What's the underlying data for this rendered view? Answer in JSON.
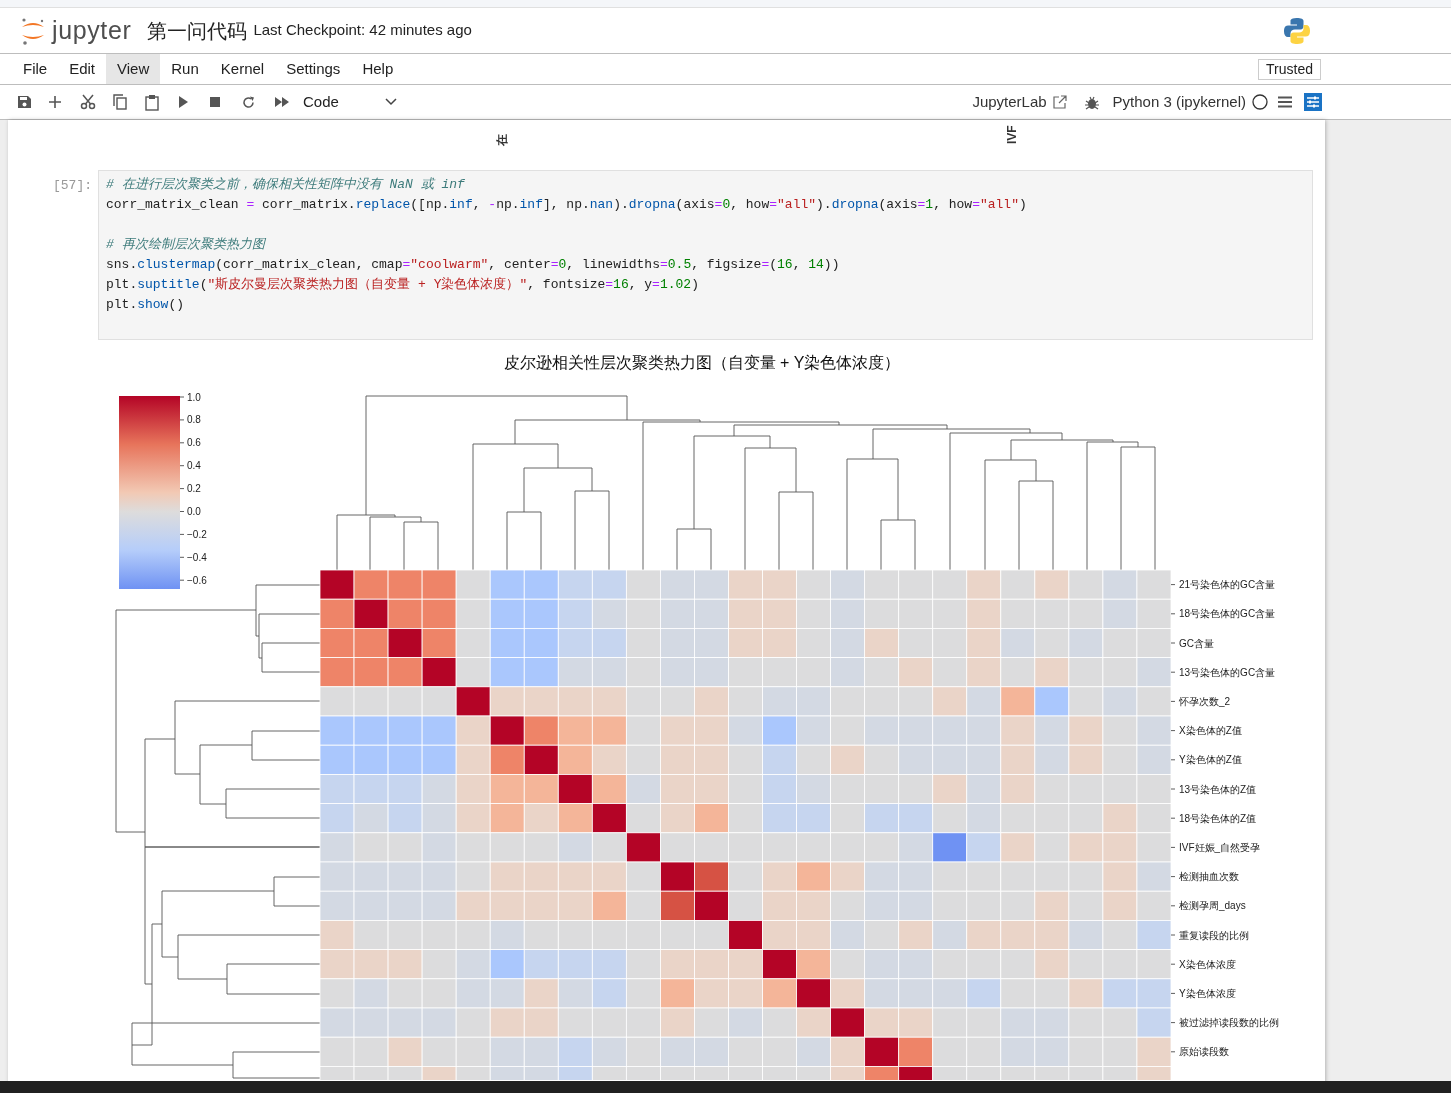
{
  "header": {
    "logo_text": "jupyter",
    "notebook_name": "第一问代码",
    "checkpoint": "Last Checkpoint: 42 minutes ago"
  },
  "menu": [
    {
      "label": "File",
      "highlighted": false
    },
    {
      "label": "Edit",
      "highlighted": false
    },
    {
      "label": "View",
      "highlighted": true
    },
    {
      "label": "Run",
      "highlighted": false
    },
    {
      "label": "Kernel",
      "highlighted": false
    },
    {
      "label": "Settings",
      "highlighted": false
    },
    {
      "label": "Help",
      "highlighted": false
    }
  ],
  "trusted": "Trusted",
  "toolbar": {
    "cell_type": "Code",
    "jupyterlab_link": "JupyterLab",
    "kernel": "Python 3 (ipykernel)",
    "kernel_busy": false
  },
  "previous_output_labels": [
    "在",
    "IVF"
  ],
  "cell": {
    "prompt": "[57]:",
    "lines": [
      {
        "tokens": [
          {
            "t": "# 在进行层次聚类之前，确保相关性矩阵中没有 NaN 或 inf",
            "kind": "comment"
          }
        ]
      },
      {
        "tokens": [
          {
            "t": "corr_matrix_clean ",
            "kind": "plain"
          },
          {
            "t": "=",
            "kind": "op"
          },
          {
            "t": " corr_matrix.",
            "kind": "plain"
          },
          {
            "t": "replace",
            "kind": "attr"
          },
          {
            "t": "([np.",
            "kind": "plain"
          },
          {
            "t": "inf",
            "kind": "attr"
          },
          {
            "t": ", ",
            "kind": "plain"
          },
          {
            "t": "-",
            "kind": "op"
          },
          {
            "t": "np.",
            "kind": "plain"
          },
          {
            "t": "inf",
            "kind": "attr"
          },
          {
            "t": "], np.",
            "kind": "plain"
          },
          {
            "t": "nan",
            "kind": "attr"
          },
          {
            "t": ").",
            "kind": "plain"
          },
          {
            "t": "dropna",
            "kind": "attr"
          },
          {
            "t": "(axis",
            "kind": "plain"
          },
          {
            "t": "=",
            "kind": "op"
          },
          {
            "t": "0",
            "kind": "number"
          },
          {
            "t": ", how",
            "kind": "plain"
          },
          {
            "t": "=",
            "kind": "op"
          },
          {
            "t": "\"all\"",
            "kind": "string"
          },
          {
            "t": ").",
            "kind": "plain"
          },
          {
            "t": "dropna",
            "kind": "attr"
          },
          {
            "t": "(axis",
            "kind": "plain"
          },
          {
            "t": "=",
            "kind": "op"
          },
          {
            "t": "1",
            "kind": "number"
          },
          {
            "t": ", how",
            "kind": "plain"
          },
          {
            "t": "=",
            "kind": "op"
          },
          {
            "t": "\"all\"",
            "kind": "string"
          },
          {
            "t": ")",
            "kind": "plain"
          }
        ]
      },
      {
        "blank_before": true,
        "tokens": [
          {
            "t": "# 再次绘制层次聚类热力图",
            "kind": "comment"
          }
        ]
      },
      {
        "tokens": [
          {
            "t": "sns.",
            "kind": "plain"
          },
          {
            "t": "clustermap",
            "kind": "attr"
          },
          {
            "t": "(corr_matrix_clean, cmap",
            "kind": "plain"
          },
          {
            "t": "=",
            "kind": "op"
          },
          {
            "t": "\"coolwarm\"",
            "kind": "string"
          },
          {
            "t": ", center",
            "kind": "plain"
          },
          {
            "t": "=",
            "kind": "op"
          },
          {
            "t": "0",
            "kind": "number"
          },
          {
            "t": ", linewidths",
            "kind": "plain"
          },
          {
            "t": "=",
            "kind": "op"
          },
          {
            "t": "0.5",
            "kind": "number"
          },
          {
            "t": ", figsize",
            "kind": "plain"
          },
          {
            "t": "=",
            "kind": "op"
          },
          {
            "t": "(",
            "kind": "plain"
          },
          {
            "t": "16",
            "kind": "number"
          },
          {
            "t": ", ",
            "kind": "plain"
          },
          {
            "t": "14",
            "kind": "number"
          },
          {
            "t": "))",
            "kind": "plain"
          }
        ]
      },
      {
        "tokens": [
          {
            "t": "plt.",
            "kind": "plain"
          },
          {
            "t": "suptitle",
            "kind": "attr"
          },
          {
            "t": "(",
            "kind": "plain"
          },
          {
            "t": "\"斯皮尔曼层次聚类热力图（自变量 + Y染色体浓度）\"",
            "kind": "string"
          },
          {
            "t": ", fontsize",
            "kind": "plain"
          },
          {
            "t": "=",
            "kind": "op"
          },
          {
            "t": "16",
            "kind": "number"
          },
          {
            "t": ", y",
            "kind": "plain"
          },
          {
            "t": "=",
            "kind": "op"
          },
          {
            "t": "1.02",
            "kind": "number"
          },
          {
            "t": ")",
            "kind": "plain"
          }
        ]
      },
      {
        "tokens": [
          {
            "t": "plt.",
            "kind": "plain"
          },
          {
            "t": "show",
            "kind": "attr"
          },
          {
            "t": "()",
            "kind": "plain"
          }
        ]
      }
    ]
  },
  "figure": {
    "title": "皮尔逊相关性层次聚类热力图（自变量 + Y染色体浓度）",
    "colorbar_ticks": [
      "1.0",
      "0.8",
      "0.6",
      "0.4",
      "0.2",
      "0.0",
      "−0.2",
      "−0.4",
      "−0.6"
    ],
    "row_labels": [
      "21号染色体的GC含量",
      "18号染色体的GC含量",
      "GC含量",
      "13号染色体的GC含量",
      "怀孕次数_2",
      "X染色体的Z值",
      "Y染色体的Z值",
      "13号染色体的Z值",
      "18号染色体的Z值",
      "IVF妊娠_自然受孕",
      "检测抽血次数",
      "检测孕周_days",
      "重复读段的比例",
      "X染色体浓度",
      "Y染色体浓度",
      "被过滤掉读段数的比例",
      "原始读段数"
    ]
  }
}
